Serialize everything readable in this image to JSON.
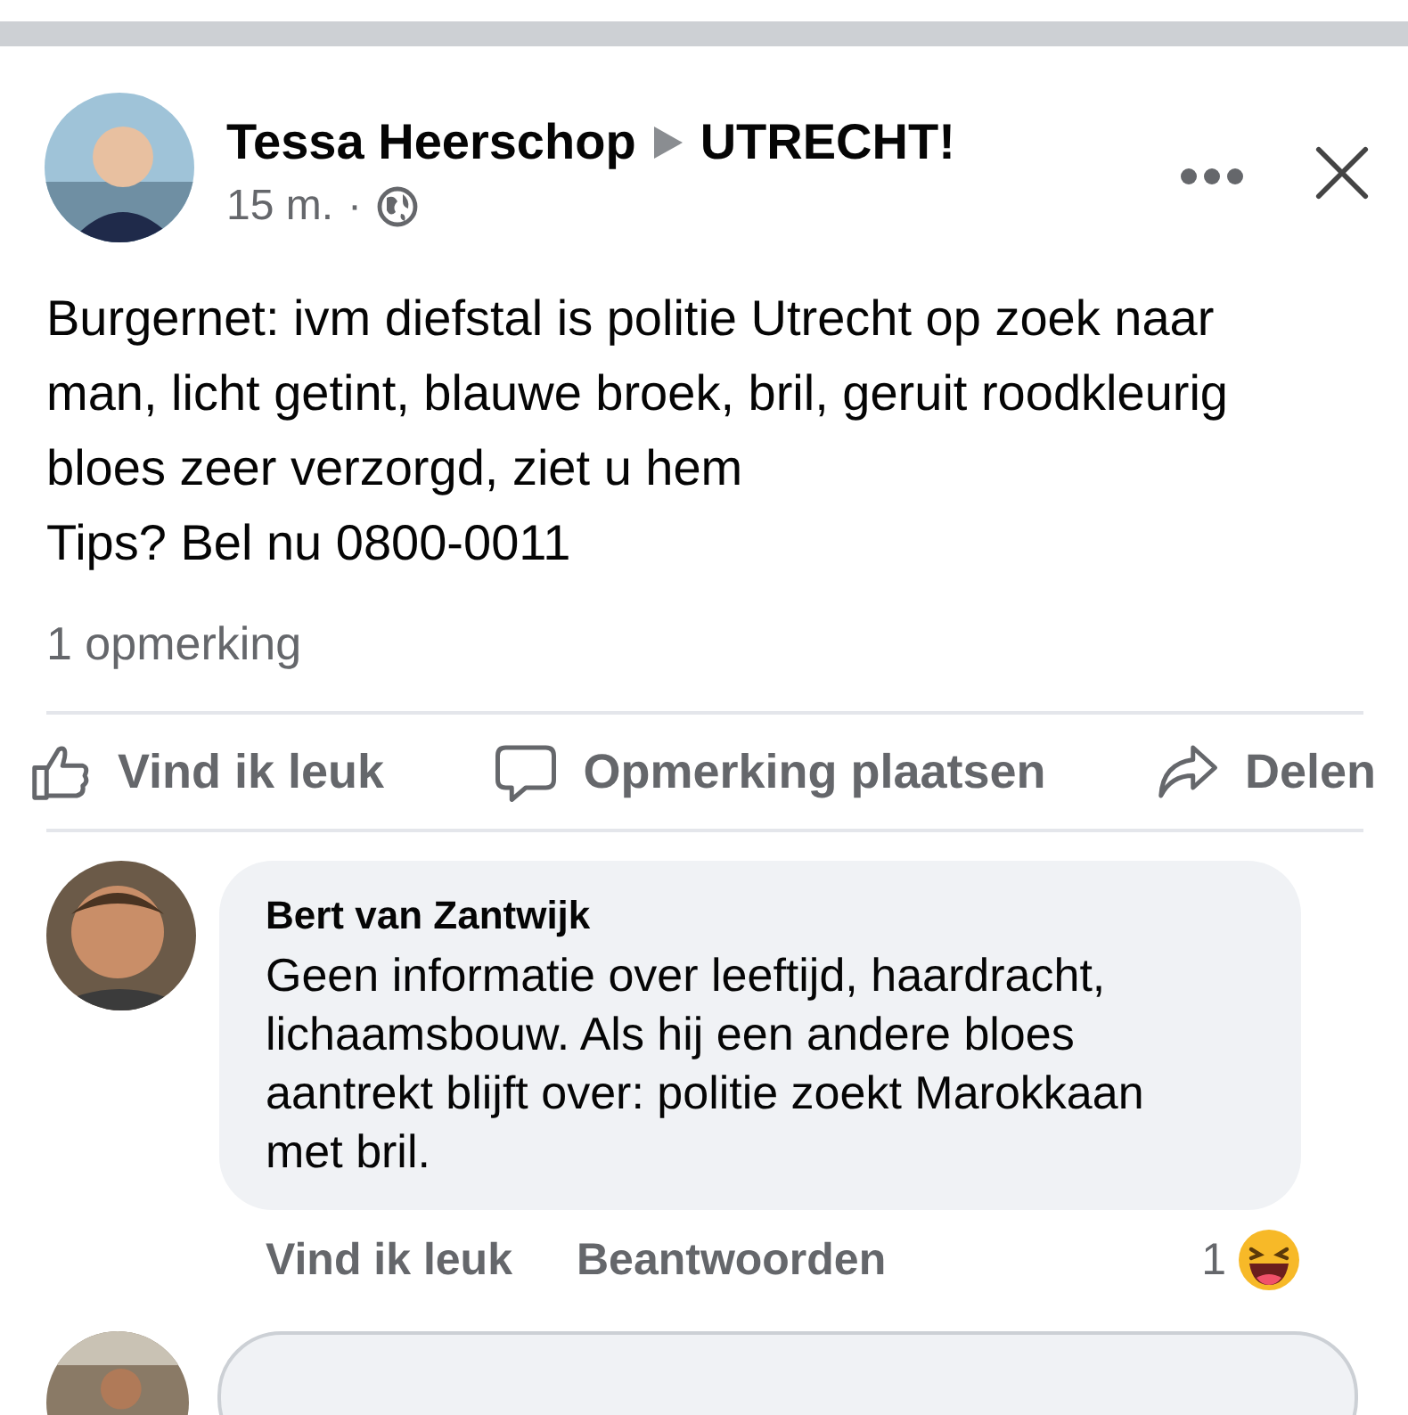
{
  "post": {
    "author": "Tessa Heerschop",
    "group": "UTRECHT!",
    "time": "15 m.",
    "separator": "·",
    "body": "Burgernet: ivm diefstal is politie Utrecht op zoek naar man, licht getint, blauwe broek, bril, geruit roodkleurig bloes zeer verzorgd, ziet u hem\nTips? Bel nu 0800-0011",
    "comment_count": "1 opmerking",
    "actions": [
      {
        "kind": "like",
        "label": "Vind ik leuk"
      },
      {
        "kind": "comment",
        "label": "Opmerking plaatsen"
      },
      {
        "kind": "share",
        "label": "Delen"
      }
    ]
  },
  "comment": {
    "author": "Bert van Zantwijk",
    "text": "Geen informatie over leeftijd, haardracht, lichaamsbouw. Als hij een andere bloes aantrekt blijft over: politie zoekt Marokkaan met bril.",
    "actions": [
      "Vind ik leuk",
      "Beantwoorden"
    ],
    "reaction_count": "1"
  }
}
